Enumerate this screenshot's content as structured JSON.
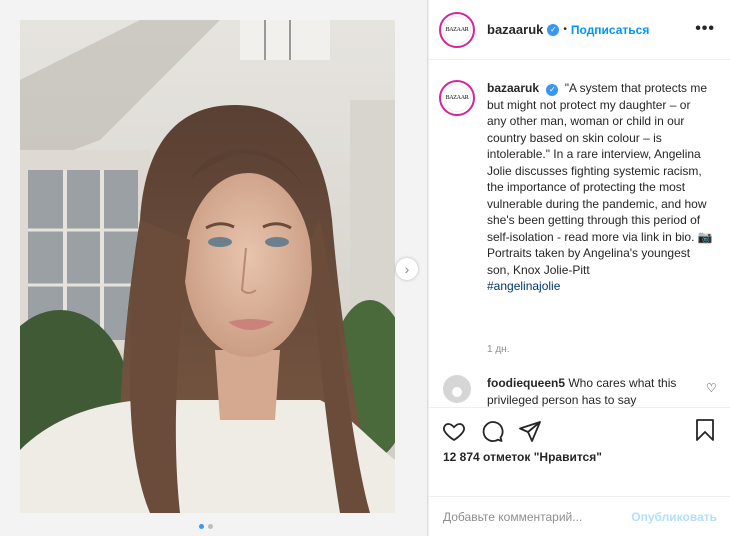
{
  "post": {
    "username": "bazaaruk",
    "avatar_text": "BAZAAR",
    "follow_label": "Подписаться",
    "separator": "•",
    "more_label": "•••"
  },
  "caption": {
    "username": "bazaaruk",
    "text": "\"A system that protects me but might not protect my daughter – or any other man, woman or child in our country based on skin colour – is intolerable.\" In a rare interview, Angelina Jolie discusses fighting systemic racism, the importance of protecting the most vulnerable during the pandemic, and how she's been getting through this period of self-isolation - read more via link in bio. 📷 Portraits taken by Angelina's youngest son, Knox Jolie-Pitt",
    "hashtag": "#angelinajolie",
    "time": "1 дн."
  },
  "comments": [
    {
      "username": "foodiequeen5",
      "text": "Who cares what this privileged person has to say"
    }
  ],
  "likes": "12 874 отметок \"Нравится\"",
  "add_comment": {
    "placeholder": "Добавьте комментарий...",
    "publish_label": "Опубликовать"
  },
  "carousel": {
    "slides": 2,
    "active": 0
  },
  "colors": {
    "accent": "#0095f6",
    "publish_disabled": "#b2dffc",
    "hashtag": "#00376b"
  },
  "icons": [
    "heart-icon",
    "comment-icon",
    "share-icon",
    "bookmark-icon",
    "chevron-right-icon",
    "verified-icon",
    "more-icon"
  ]
}
